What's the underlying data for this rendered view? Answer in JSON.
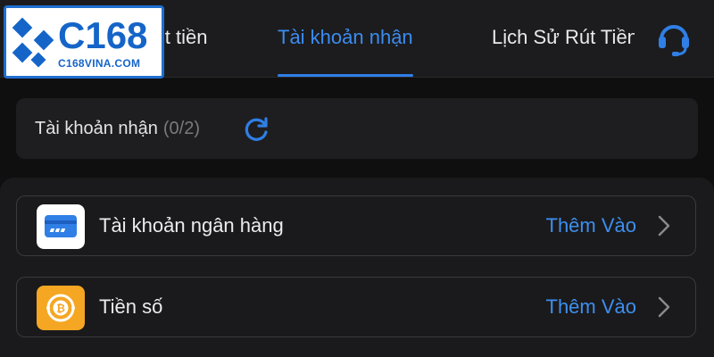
{
  "logo": {
    "text": "C168",
    "subtext": "C168VINA.COM"
  },
  "tabs": [
    {
      "label": "ứt tiền",
      "active": false
    },
    {
      "label": "Tài khoản nhận",
      "active": true
    },
    {
      "label": "Lịch Sử Rút Tiền",
      "active": false
    }
  ],
  "header_icons": {
    "support": "headset-icon"
  },
  "account_section": {
    "title": "Tài khoản nhận",
    "count": "(0/2)",
    "refresh_icon": "refresh-icon"
  },
  "options": [
    {
      "label": "Tài khoản ngân hàng",
      "action": "Thêm Vào",
      "icon": "bank-card-icon"
    },
    {
      "label": "Tiền số",
      "action": "Thêm Vào",
      "icon": "bitcoin-icon"
    }
  ],
  "colors": {
    "accent": "#3b8cf0",
    "background": "#0f0f10",
    "card": "#1e1e20",
    "crypto_icon": "#f5a623"
  }
}
